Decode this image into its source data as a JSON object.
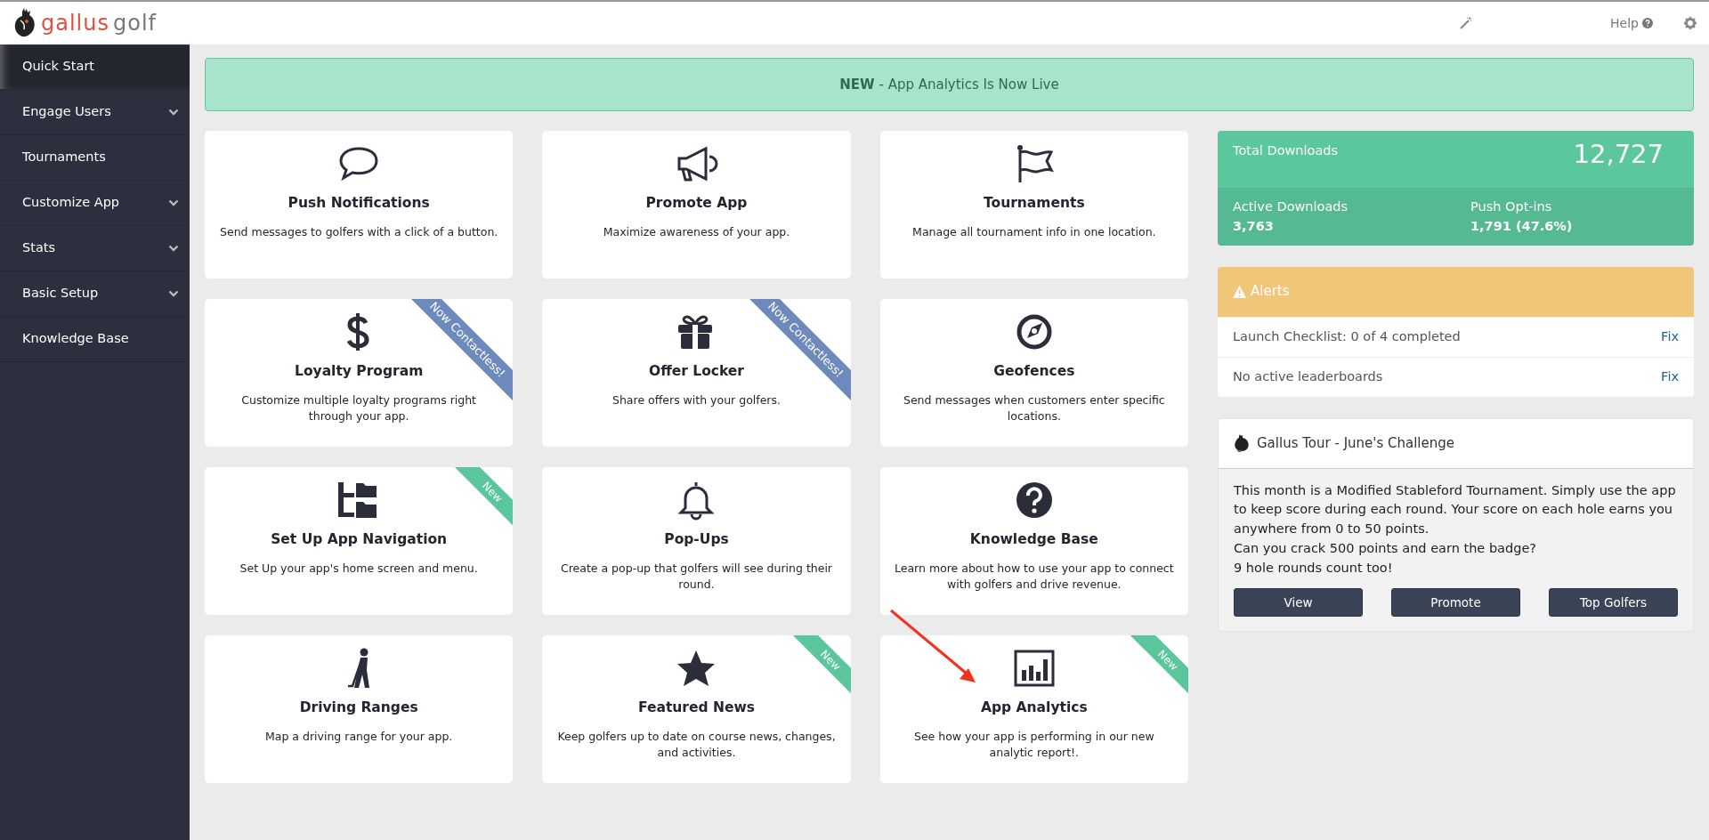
{
  "header": {
    "logo": {
      "primary": "gallus",
      "secondary": "golf"
    },
    "help": "Help"
  },
  "sidebar": {
    "items": [
      {
        "label": "Quick Start",
        "selected": true,
        "expandable": false
      },
      {
        "label": "Engage Users",
        "selected": false,
        "expandable": true
      },
      {
        "label": "Tournaments",
        "selected": false,
        "expandable": false
      },
      {
        "label": "Customize App",
        "selected": false,
        "expandable": true
      },
      {
        "label": "Stats",
        "selected": false,
        "expandable": true
      },
      {
        "label": "Basic Setup",
        "selected": false,
        "expandable": true
      },
      {
        "label": "Knowledge Base",
        "selected": false,
        "expandable": false
      }
    ]
  },
  "banner": "**NEW** - App Analytics Is Now Live",
  "tiles": [
    {
      "kind": "chat",
      "title": "Push Notifications",
      "description": "Send messages to golfers with a click of a button."
    },
    {
      "kind": "megaphone",
      "title": "Promote App",
      "description": "Maximize awareness of your app."
    },
    {
      "kind": "flag",
      "title": "Tournaments",
      "description": "Manage all tournament info in one location."
    },
    {
      "kind": "dollar",
      "title": "Loyalty Program",
      "description": "Customize multiple loyalty programs right through your app.",
      "ribbon": {
        "text": "Now Contactless!",
        "color": "#6e89bb"
      }
    },
    {
      "kind": "gift",
      "title": "Offer Locker",
      "description": "Share offers with your golfers.",
      "ribbon": {
        "text": "Now Contactless!",
        "color": "#6e89bb"
      }
    },
    {
      "kind": "compass",
      "title": "Geofences",
      "description": "Send messages when customers enter specific locations."
    },
    {
      "kind": "folders",
      "title": "Set Up App Navigation",
      "description": "Set Up your app's home screen and menu.",
      "ribbon": {
        "text": "New",
        "color": "#5bc69b"
      }
    },
    {
      "kind": "bell",
      "title": "Pop-Ups",
      "description": "Create a pop-up that golfers will see during their round."
    },
    {
      "kind": "question",
      "title": "Knowledge Base",
      "description": "Learn more about how to use your app to connect with golfers and drive revenue."
    },
    {
      "kind": "golfer",
      "title": "Driving Ranges",
      "description": "Map a driving range for your app."
    },
    {
      "kind": "star",
      "title": "Featured News",
      "description": "Keep golfers up to date on course news, changes, and activities.",
      "ribbon": {
        "text": "New",
        "color": "#5bc69b"
      }
    },
    {
      "kind": "chart",
      "title": "App Analytics",
      "description": "See how your app is performing in our new analytic report!.",
      "ribbon": {
        "text": "New",
        "color": "#5bc69b"
      }
    }
  ],
  "stats": {
    "total_label": "Total Downloads",
    "total_value": "12,727",
    "active_label": "Active Downloads",
    "active_value": "3,763",
    "push_label": "Push Opt-ins",
    "push_value": "1,791 (47.6%)"
  },
  "alerts": {
    "title": "Alerts",
    "items": [
      {
        "text": "Launch Checklist: 0 of 4 completed",
        "action": "Fix"
      },
      {
        "text": "No active leaderboards",
        "action": "Fix"
      }
    ]
  },
  "challenge": {
    "title": "Gallus Tour - June's Challenge",
    "paragraphs": [
      "This month is a Modified Stableford Tournament. Simply use the app to keep score during each round. Your score on each hole earns you anywhere from 0 to 50 points.",
      "Can you crack 500 points and earn the badge?",
      "9 hole rounds count too!"
    ],
    "buttons": [
      "View",
      "Promote",
      "Top Golfers"
    ]
  }
}
